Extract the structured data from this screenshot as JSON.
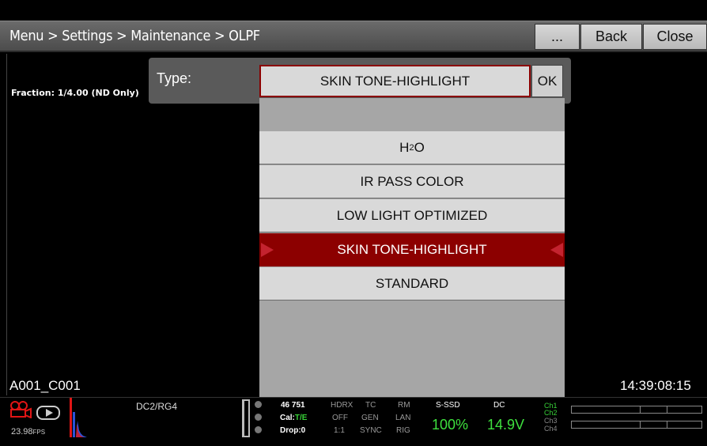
{
  "titlebar": {
    "breadcrumb": "Menu > Settings > Maintenance > OLPF",
    "more_label": "...",
    "back_label": "Back",
    "close_label": "Close"
  },
  "viewport": {
    "fraction": "Fraction: 1/4.00 (ND Only)",
    "clip_name": "A001_C001",
    "timecode": "14:39:08:15"
  },
  "type_panel": {
    "label": "Type:",
    "value": "SKIN TONE-HIGHLIGHT",
    "ok_label": "OK"
  },
  "dropdown": {
    "options": [
      {
        "label": "H",
        "sub": "2",
        "after": "O"
      },
      {
        "label": "IR PASS COLOR"
      },
      {
        "label": "LOW LIGHT OPTIMIZED"
      },
      {
        "label": "SKIN TONE-HIGHLIGHT",
        "selected": true
      },
      {
        "label": "STANDARD"
      }
    ]
  },
  "statusbar": {
    "fps_value": "23.98",
    "fps_unit": "FPS",
    "look": "DC2/RG4",
    "temp": "46 751",
    "cal_label": "Cal:",
    "cal_value": "T/E",
    "drop": "Drop:0",
    "hdrx": "HDRX",
    "hdrx_val": "OFF",
    "hdrx_ratio": "1:1",
    "tc": "TC",
    "tc_val": "GEN",
    "tc_sync": "SYNC",
    "rm": "RM",
    "rm_val": "LAN",
    "rm_rig": "RIG",
    "media": "S-SSD",
    "media_val": "100%",
    "power": "DC",
    "power_val": "14.9V",
    "channels": [
      "Ch1",
      "Ch2",
      "Ch3",
      "Ch4"
    ]
  },
  "colors": {
    "selected_bg": "#8c0000",
    "accent_green": "#3ee03e",
    "accent_red": "#e01515"
  }
}
